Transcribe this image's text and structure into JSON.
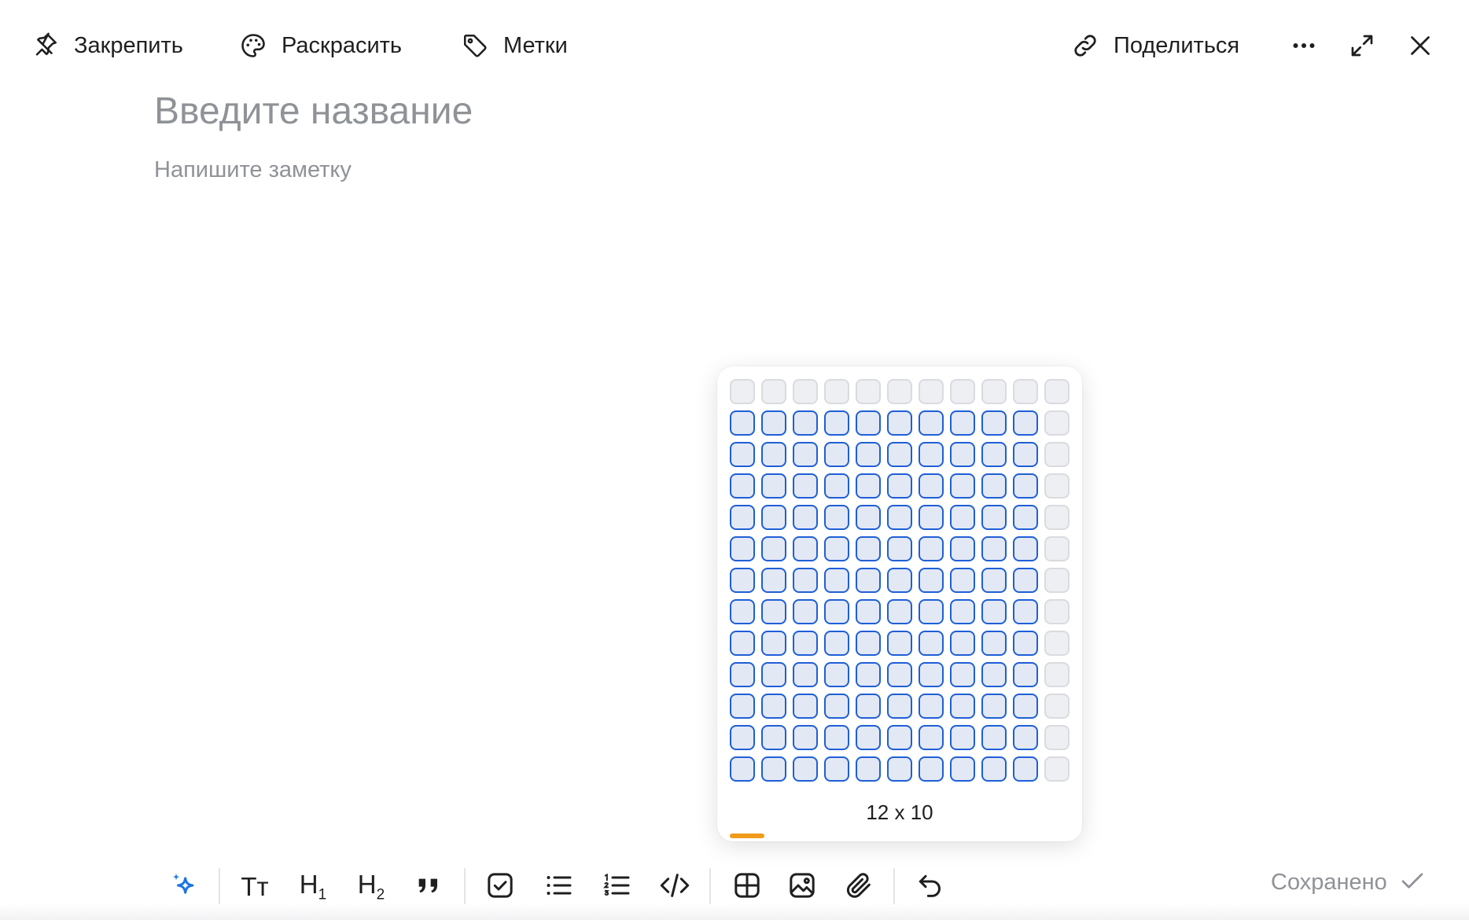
{
  "toolbar": {
    "pin": {
      "label": "Закрепить",
      "icon": "pin-icon"
    },
    "color": {
      "label": "Раскрасить",
      "icon": "palette-icon"
    },
    "tags": {
      "label": "Метки",
      "icon": "tag-icon"
    },
    "share": {
      "label": "Поделиться",
      "icon": "link-icon"
    },
    "more_icon": "more-horizontal-icon",
    "expand_icon": "expand-icon",
    "close_icon": "close-icon"
  },
  "note": {
    "title_placeholder": "Введите название",
    "body_placeholder": "Напишите заметку"
  },
  "table_picker": {
    "rows": 13,
    "cols": 11,
    "selected_rows": 12,
    "selected_cols": 10,
    "size_label": "12 x 10"
  },
  "format_toolbar": {
    "ai": {
      "icon": "sparkle-icon"
    },
    "text_size": {
      "text": "Тт"
    },
    "heading1": {
      "letter": "H",
      "sub": "1"
    },
    "heading2": {
      "letter": "H",
      "sub": "2"
    },
    "quote": {
      "icon": "quote-icon"
    },
    "checklist": {
      "icon": "checkbox-icon"
    },
    "bullet_list": {
      "icon": "bullet-list-icon"
    },
    "numbered_list": {
      "icon": "numbered-list-icon"
    },
    "code": {
      "icon": "code-icon"
    },
    "table": {
      "icon": "table-icon",
      "active": true
    },
    "image": {
      "icon": "image-icon"
    },
    "attachment": {
      "icon": "paperclip-icon"
    },
    "undo": {
      "icon": "undo-icon"
    }
  },
  "status": {
    "text": "Сохранено",
    "icon": "check-icon"
  },
  "colors": {
    "accent": "#1f5fd6",
    "active_underline": "#f29a1a",
    "ai": "#1a73e8",
    "muted": "#8f9297"
  }
}
